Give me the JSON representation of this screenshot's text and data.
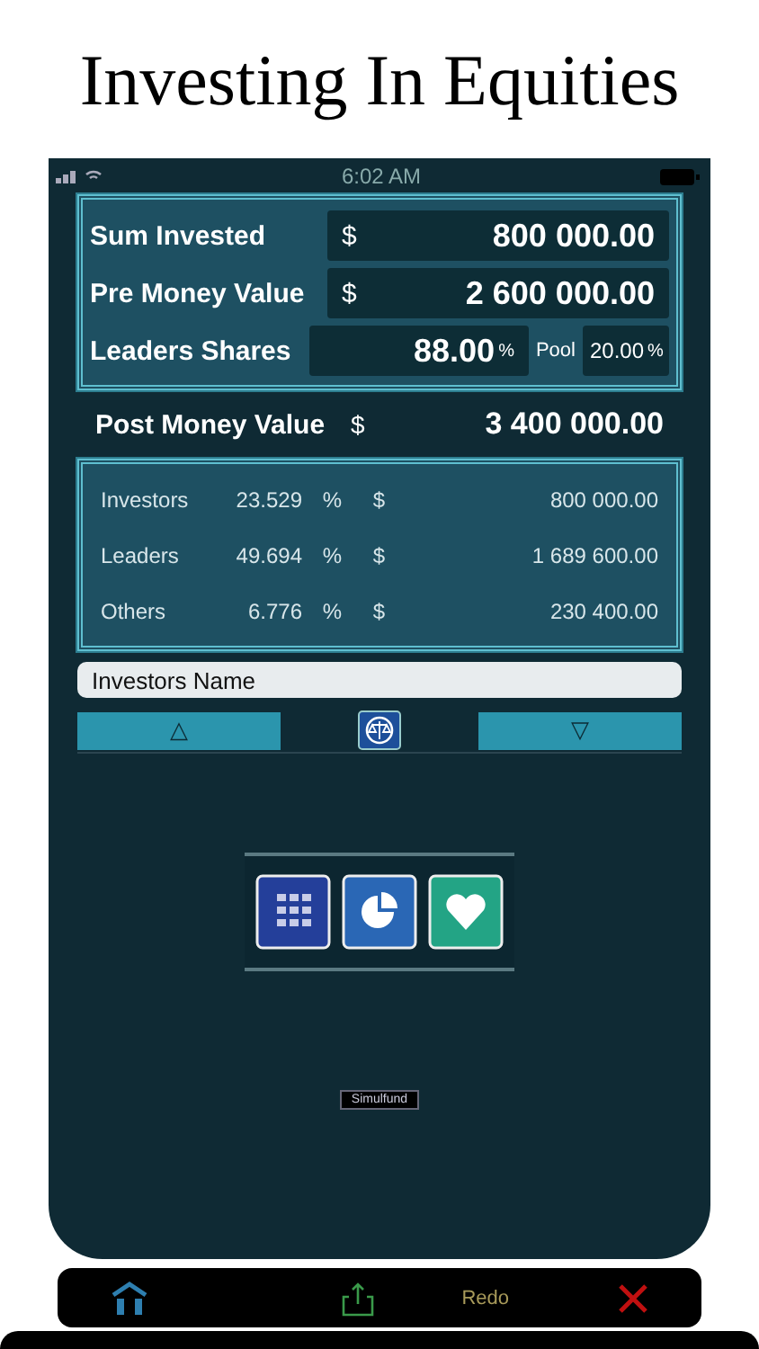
{
  "title": "Investing In Equities",
  "status_bar": {
    "time": "6:02 AM"
  },
  "inputs": [
    {
      "kind": "money",
      "label": "Sum Invested",
      "currency": "$",
      "value": "800 000.00"
    },
    {
      "kind": "money",
      "label": "Pre Money Value",
      "currency": "$",
      "value": "2 600 000.00"
    },
    {
      "kind": "percent",
      "label": "Leaders Shares",
      "value": "88.00",
      "unit": "%",
      "pool_label": "Pool",
      "pool_value": "20.00",
      "pool_unit": "%"
    }
  ],
  "post_money": {
    "label": "Post Money Value",
    "currency": "$",
    "value": "3 400 000.00"
  },
  "breakdown": [
    {
      "label": "Investors",
      "percent": "23.529",
      "unit": "%",
      "currency": "$",
      "value": "800 000.00"
    },
    {
      "label": "Leaders",
      "percent": "49.694",
      "unit": "%",
      "currency": "$",
      "value": "1 689 600.00"
    },
    {
      "label": "Others",
      "percent": "6.776",
      "unit": "%",
      "currency": "$",
      "value": "230 400.00"
    }
  ],
  "name_field": {
    "value": "Investors Name"
  },
  "nav": {
    "up": "△",
    "down": "▽"
  },
  "badge": "Simulfund",
  "toolbar": {
    "redo": "Redo"
  }
}
